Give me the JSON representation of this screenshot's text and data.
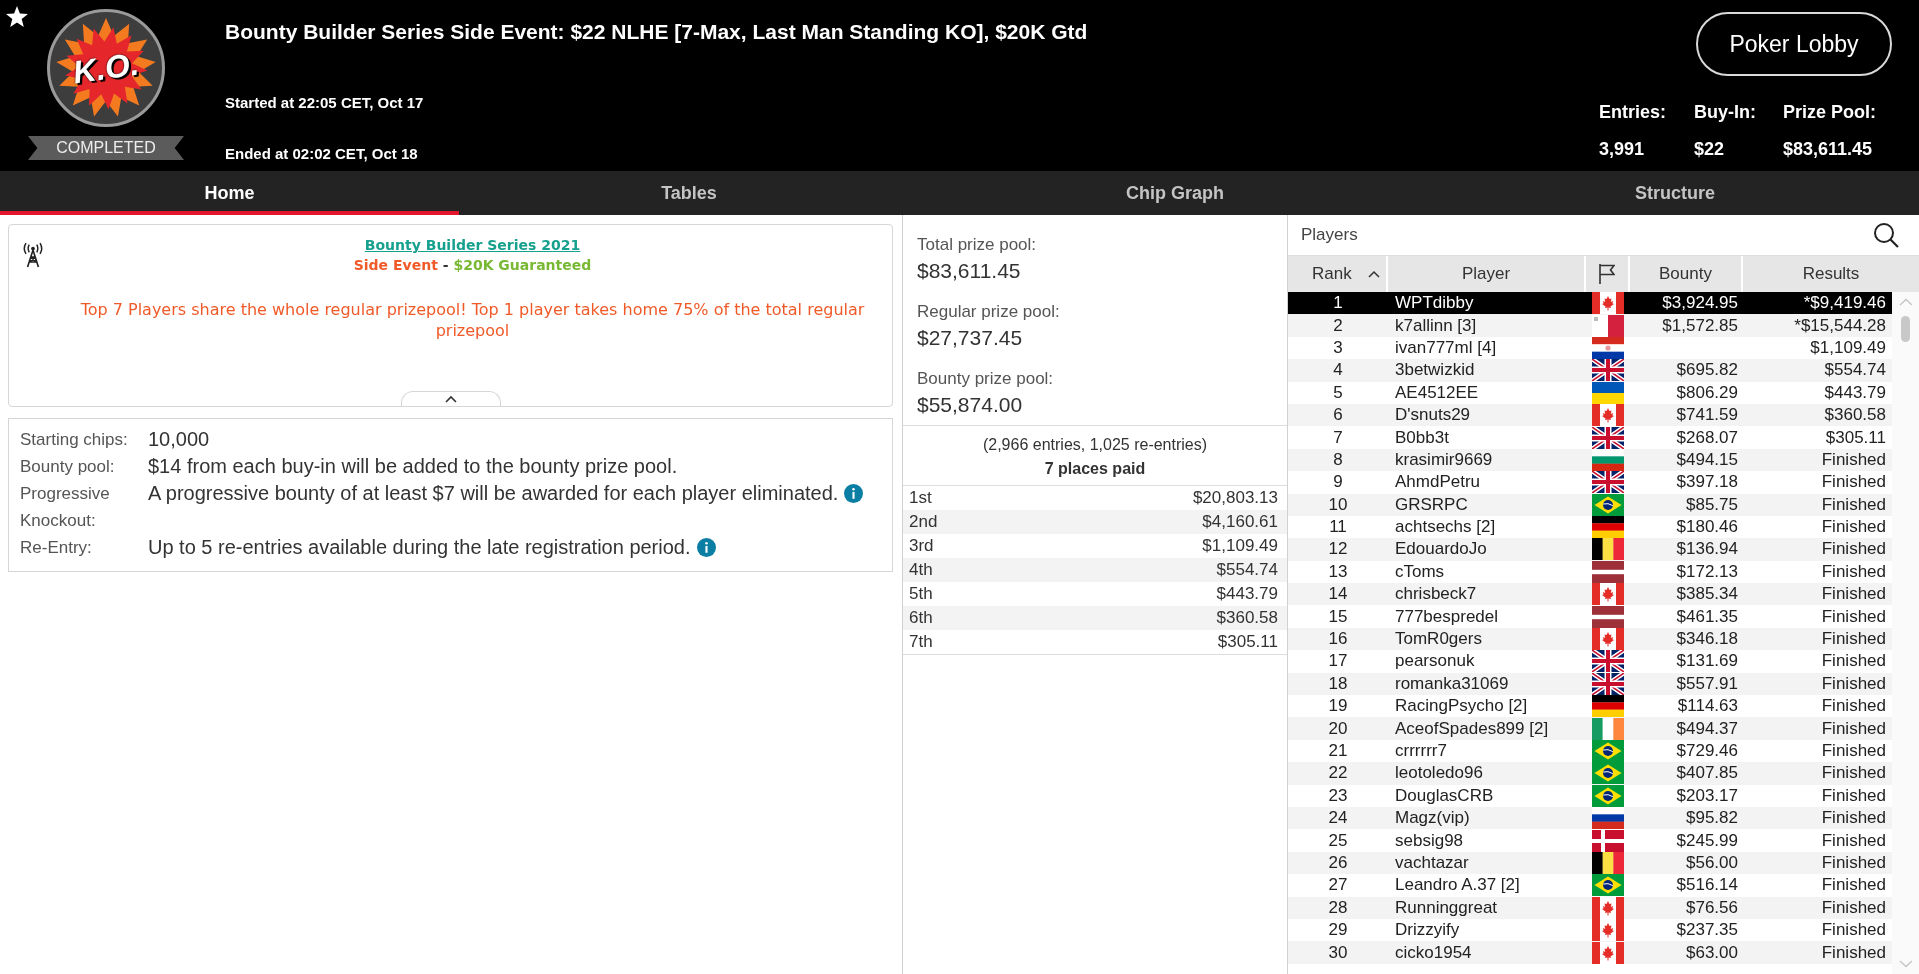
{
  "header": {
    "logo_text": "K.O.",
    "status": "COMPLETED",
    "title": "Bounty Builder Series Side Event: $22 NLHE [7-Max, Last Man Standing KO], $20K Gtd",
    "started": "Started at 22:05 CET, Oct 17",
    "ended": "Ended at 02:02 CET, Oct 18",
    "lobby_button": "Poker Lobby",
    "stats": [
      {
        "label": "Entries:",
        "value": "3,991"
      },
      {
        "label": "Buy-In:",
        "value": "$22"
      },
      {
        "label": "Prize Pool:",
        "value": "$83,611.45"
      }
    ]
  },
  "tabs": [
    {
      "label": "Home",
      "selected": true
    },
    {
      "label": "Tables",
      "selected": false
    },
    {
      "label": "Chip Graph",
      "selected": false
    },
    {
      "label": "Structure",
      "selected": false
    }
  ],
  "announcement": {
    "title": "Bounty Builder Series 2021",
    "subtitle": [
      {
        "text": "Side Event",
        "color": "#f05a28"
      },
      {
        "text": " - ",
        "color": "#333333"
      },
      {
        "text": "$20K Guaranteed",
        "color": "#78b833"
      }
    ],
    "body": "Top 7 Players share the whole regular prizepool! Top 1 player takes home 75% of the total regular prizepool"
  },
  "details": [
    {
      "label": "Starting chips:",
      "value": "10,000",
      "info": false
    },
    {
      "label": "Bounty pool:",
      "value": "$14 from each buy-in will be added to the bounty prize pool.",
      "info": false
    },
    {
      "label": "Progressive Knockout:",
      "value": "A progressive bounty of at least $7 will be awarded for each player eliminated.",
      "info": true
    },
    {
      "label": "Re-Entry:",
      "value": "Up to 5 re-entries available during the late registration period.",
      "info": true
    }
  ],
  "prize_pools": [
    {
      "label": "Total prize pool:",
      "value": "$83,611.45"
    },
    {
      "label": "Regular prize pool:",
      "value": "$27,737.45"
    },
    {
      "label": "Bounty prize pool:",
      "value": "$55,874.00"
    }
  ],
  "entries_note": "(2,966 entries, 1,025 re-entries)",
  "places_paid": "7 places paid",
  "payouts": [
    {
      "place": "1st",
      "amount": "$20,803.13"
    },
    {
      "place": "2nd",
      "amount": "$4,160.61"
    },
    {
      "place": "3rd",
      "amount": "$1,109.49"
    },
    {
      "place": "4th",
      "amount": "$554.74"
    },
    {
      "place": "5th",
      "amount": "$443.79"
    },
    {
      "place": "6th",
      "amount": "$360.58"
    },
    {
      "place": "7th",
      "amount": "$305.11"
    }
  ],
  "players": {
    "title": "Players",
    "columns": [
      {
        "kind": "text",
        "label": "Rank",
        "sorted": true
      },
      {
        "kind": "text",
        "label": "Player",
        "sorted": false
      },
      {
        "kind": "flag",
        "sorted": false
      },
      {
        "kind": "text",
        "label": "Bounty",
        "sorted": false
      },
      {
        "kind": "text",
        "label": "Results",
        "sorted": false
      }
    ],
    "rows": [
      {
        "rank": "1",
        "player": "WPTdibby",
        "flag": {
          "kind": "ca"
        },
        "bounty": "$3,924.95",
        "result": "*$9,419.46",
        "selected": true
      },
      {
        "rank": "2",
        "player": "k7allinn [3]",
        "flag": {
          "kind": "mt"
        },
        "bounty": "$1,572.85",
        "result": "*$15,544.28",
        "selected": false
      },
      {
        "rank": "3",
        "player": "ivan777ml [4]",
        "flag": {
          "kind": "py"
        },
        "result": "$1,109.49",
        "selected": false
      },
      {
        "rank": "4",
        "player": "3betwizkid",
        "flag": {
          "kind": "gb"
        },
        "bounty": "$695.82",
        "result": "$554.74",
        "selected": false
      },
      {
        "rank": "5",
        "player": "AE4512EE",
        "flag": {
          "kind": "ua"
        },
        "bounty": "$806.29",
        "result": "$443.79",
        "selected": false
      },
      {
        "rank": "6",
        "player": "D'snuts29",
        "flag": {
          "kind": "ca"
        },
        "bounty": "$741.59",
        "result": "$360.58",
        "selected": false
      },
      {
        "rank": "7",
        "player": "B0bb3t",
        "flag": {
          "kind": "gb"
        },
        "bounty": "$268.07",
        "result": "$305.11",
        "selected": false
      },
      {
        "rank": "8",
        "player": "krasimir9669",
        "flag": {
          "kind": "bg"
        },
        "bounty": "$494.15",
        "result": "Finished",
        "selected": false
      },
      {
        "rank": "9",
        "player": "AhmdPetru",
        "flag": {
          "kind": "gb"
        },
        "bounty": "$397.18",
        "result": "Finished",
        "selected": false
      },
      {
        "rank": "10",
        "player": "GRSRPC",
        "flag": {
          "kind": "br"
        },
        "bounty": "$85.75",
        "result": "Finished",
        "selected": false
      },
      {
        "rank": "11",
        "player": "achtsechs [2]",
        "flag": {
          "kind": "de"
        },
        "bounty": "$180.46",
        "result": "Finished",
        "selected": false
      },
      {
        "rank": "12",
        "player": "EdouardoJo",
        "flag": {
          "kind": "be"
        },
        "bounty": "$136.94",
        "result": "Finished",
        "selected": false
      },
      {
        "rank": "13",
        "player": "cToms",
        "flag": {
          "kind": "lv"
        },
        "bounty": "$172.13",
        "result": "Finished",
        "selected": false
      },
      {
        "rank": "14",
        "player": "chrisbeck7",
        "flag": {
          "kind": "ca"
        },
        "bounty": "$385.34",
        "result": "Finished",
        "selected": false
      },
      {
        "rank": "15",
        "player": "777bespredel",
        "flag": {
          "kind": "lv"
        },
        "bounty": "$461.35",
        "result": "Finished",
        "selected": false
      },
      {
        "rank": "16",
        "player": "TomR0gers",
        "flag": {
          "kind": "ca"
        },
        "bounty": "$346.18",
        "result": "Finished",
        "selected": false
      },
      {
        "rank": "17",
        "player": "pearsonuk",
        "flag": {
          "kind": "gb"
        },
        "bounty": "$131.69",
        "result": "Finished",
        "selected": false
      },
      {
        "rank": "18",
        "player": "romanka31069",
        "flag": {
          "kind": "gb"
        },
        "bounty": "$557.91",
        "result": "Finished",
        "selected": false
      },
      {
        "rank": "19",
        "player": "RacingPsycho [2]",
        "flag": {
          "kind": "de"
        },
        "bounty": "$114.63",
        "result": "Finished",
        "selected": false
      },
      {
        "rank": "20",
        "player": "AceofSpades899 [2]",
        "flag": {
          "kind": "ie"
        },
        "bounty": "$494.37",
        "result": "Finished",
        "selected": false
      },
      {
        "rank": "21",
        "player": "crrrrrr7",
        "flag": {
          "kind": "br"
        },
        "bounty": "$729.46",
        "result": "Finished",
        "selected": false
      },
      {
        "rank": "22",
        "player": "leotoledo96",
        "flag": {
          "kind": "br"
        },
        "bounty": "$407.85",
        "result": "Finished",
        "selected": false
      },
      {
        "rank": "23",
        "player": "DouglasCRB",
        "flag": {
          "kind": "br"
        },
        "bounty": "$203.17",
        "result": "Finished",
        "selected": false
      },
      {
        "rank": "24",
        "player": "Magz(vip)",
        "flag": {
          "kind": "ru"
        },
        "bounty": "$95.82",
        "result": "Finished",
        "selected": false
      },
      {
        "rank": "25",
        "player": "sebsig98",
        "flag": {
          "kind": "dk"
        },
        "bounty": "$245.99",
        "result": "Finished",
        "selected": false
      },
      {
        "rank": "26",
        "player": "vachtazar",
        "flag": {
          "kind": "be"
        },
        "bounty": "$56.00",
        "result": "Finished",
        "selected": false
      },
      {
        "rank": "27",
        "player": "Leandro A.37 [2]",
        "flag": {
          "kind": "br"
        },
        "bounty": "$516.14",
        "result": "Finished",
        "selected": false
      },
      {
        "rank": "28",
        "player": "Runninggreat",
        "flag": {
          "kind": "ca"
        },
        "bounty": "$76.56",
        "result": "Finished",
        "selected": false
      },
      {
        "rank": "29",
        "player": "Drizzyify",
        "flag": {
          "kind": "ca"
        },
        "bounty": "$237.35",
        "result": "Finished",
        "selected": false
      },
      {
        "rank": "30",
        "player": "cicko1954",
        "flag": {
          "kind": "ca"
        },
        "bounty": "$63.00",
        "result": "Finished",
        "selected": false
      }
    ]
  }
}
